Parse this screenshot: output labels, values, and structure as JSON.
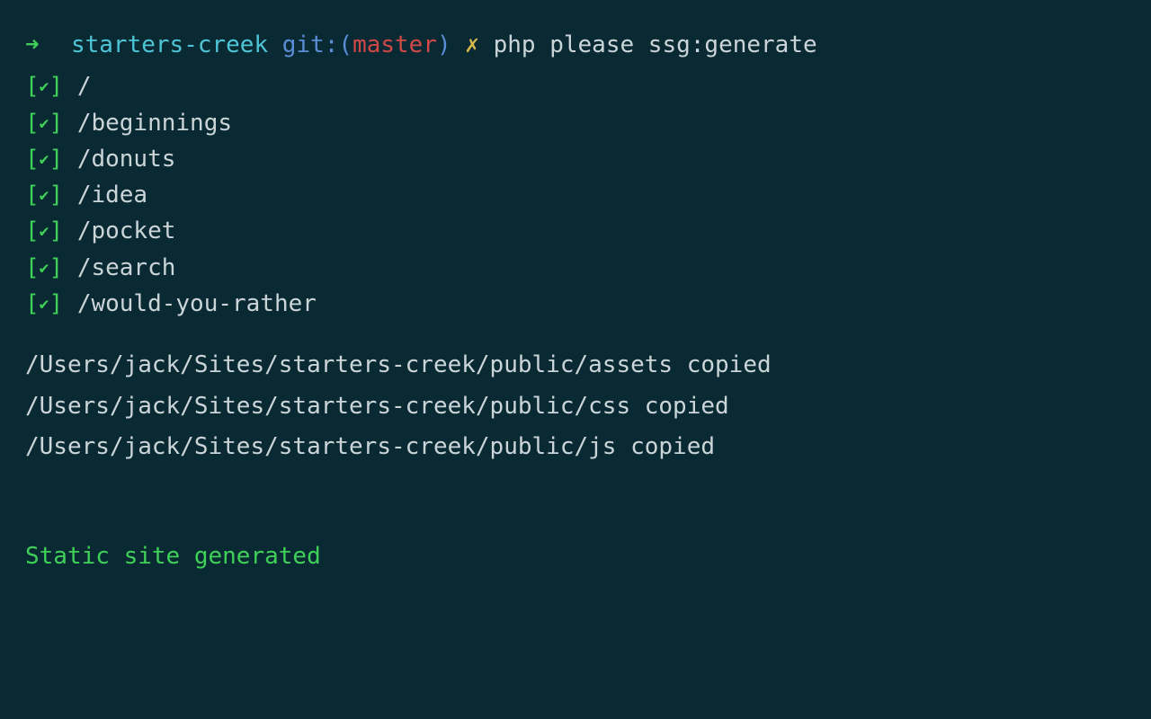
{
  "prompt": {
    "arrow": "➜",
    "dirname": "starters-creek",
    "git_label": "git:",
    "git_paren_open": "(",
    "git_branch": "master",
    "git_paren_close": ")",
    "dirty_mark": "✗",
    "command": "php please ssg:generate"
  },
  "routes": [
    {
      "check": "✔",
      "path": "/"
    },
    {
      "check": "✔",
      "path": "/beginnings"
    },
    {
      "check": "✔",
      "path": "/donuts"
    },
    {
      "check": "✔",
      "path": "/idea"
    },
    {
      "check": "✔",
      "path": "/pocket"
    },
    {
      "check": "✔",
      "path": "/search"
    },
    {
      "check": "✔",
      "path": "/would-you-rather"
    }
  ],
  "copied": [
    "/Users/jack/Sites/starters-creek/public/assets copied",
    "/Users/jack/Sites/starters-creek/public/css copied",
    "/Users/jack/Sites/starters-creek/public/js copied"
  ],
  "status": "Static site generated"
}
